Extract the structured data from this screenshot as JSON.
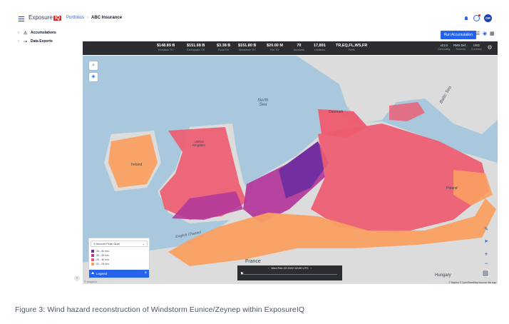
{
  "app": {
    "brand_text": "Exposure",
    "brand_badge": "IQ",
    "avatar_initials": "GR",
    "icons": [
      "menu-icon",
      "bell-icon",
      "user-icon"
    ]
  },
  "breadcrumb": {
    "root": "Portfolios",
    "separator": "›",
    "current": "ABC Insurance"
  },
  "sidebar": {
    "items": [
      {
        "label": "Accumulations",
        "icon": "warning-icon",
        "chevron": "›"
      },
      {
        "label": "Data Exports",
        "icon": "export-icon",
        "chevron": "›"
      }
    ],
    "collapse_glyph": "‹"
  },
  "toolbar": {
    "run_label": "Run Accumulation"
  },
  "stats": [
    {
      "value": "$148.89 B",
      "label": "Exclusion TIV"
    },
    {
      "value": "$151.68 B",
      "label": "Earthquake TIV"
    },
    {
      "value": "$3.38 B",
      "label": "Flood TIV"
    },
    {
      "value": "$151.80 B",
      "label": "Windstorm TIV"
    },
    {
      "value": "$20.00 M",
      "label": "Fire TIV"
    },
    {
      "value": "70",
      "label": "Accounts"
    },
    {
      "value": "17,891",
      "label": "Locations"
    },
    {
      "value": "TR,EQ,FL,WS,FR",
      "label": "Perils"
    }
  ],
  "stats_right": [
    {
      "value": "v21.0",
      "label": "Geocoding"
    },
    {
      "value": "RMS Def...",
      "label": "Schema"
    },
    {
      "value": "USD",
      "label": "Currency"
    }
  ],
  "map": {
    "labels": {
      "north_sea": "North\nSea",
      "baltic_sea": "Baltic Sea",
      "france": "France",
      "hungary": "Hungary",
      "denmark": "Denmark",
      "ireland": "Ireland",
      "poland": "Poland",
      "english_channel": "English Channel",
      "united_kingdom": "United\nKingdom"
    },
    "attribution": "© Mapbox © OpenStreetMap  Improve this map",
    "logo_text": "© mapbox",
    "controls": [
      "search-icon",
      "layers-icon",
      "pencil-icon",
      "locate-icon",
      "zoom-in-icon",
      "zoom-out-icon"
    ],
    "zoom_in": "+",
    "zoom_out": "−"
  },
  "legend": {
    "selector_value": "3 Second Peak Gust",
    "dropdown_glyph": "⌄",
    "rows": [
      {
        "label": "35 - 40 m/s",
        "color": "#6b2ea0"
      },
      {
        "label": "30 - 35 m/s",
        "color": "#b23a9b"
      },
      {
        "label": "25 - 30 m/s",
        "color": "#ee5a6f"
      },
      {
        "label": "20 - 25 m/s",
        "color": "#f9a062"
      }
    ],
    "bar_label": "Legend",
    "bar_icon_glyph": "⛰",
    "close_glyph": "×"
  },
  "timeline": {
    "label": "Wed Feb 23 2022 00:00 UTC",
    "prev": "‹",
    "next": "›",
    "play": "▶"
  },
  "caption": "Figure 3: Wind hazard reconstruction of Windstorm Eunice/Zeynep within ExposureIQ"
}
